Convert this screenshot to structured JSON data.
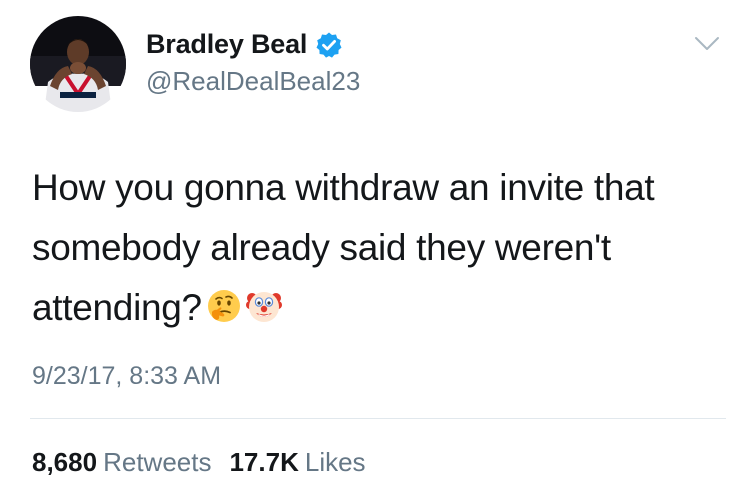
{
  "author": {
    "display_name": "Bradley Beal",
    "handle": "@RealDealBeal23",
    "verified": true
  },
  "tweet": {
    "text_lines": [
      "How you gonna withdraw an invite that",
      "somebody already said they weren't",
      "attending?"
    ],
    "emojis": [
      "thinking-face",
      "clown-face"
    ],
    "timestamp": "9/23/17, 8:33 AM"
  },
  "stats": {
    "retweets_count": "8,680",
    "retweets_label": "Retweets",
    "likes_count": "17.7K",
    "likes_label": "Likes"
  },
  "colors": {
    "text": "#14171a",
    "secondary": "#657786",
    "verified_blue": "#1da1f2",
    "divider": "#e1e8ed"
  },
  "icons": [
    "avatar",
    "verified-badge-icon",
    "chevron-down-icon",
    "thinking-face-emoji",
    "clown-face-emoji"
  ]
}
